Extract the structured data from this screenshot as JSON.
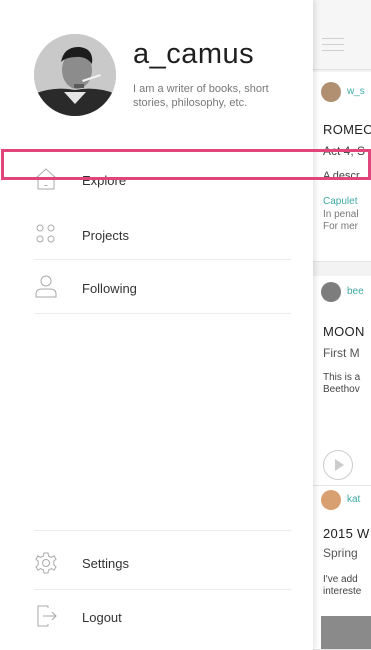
{
  "profile": {
    "username": "a_camus",
    "bio": "I am a writer of books, short stories, philosophy, etc."
  },
  "menu": {
    "explore": "Explore",
    "projects": "Projects",
    "following": "Following",
    "settings": "Settings",
    "logout": "Logout"
  },
  "feed": {
    "card1": {
      "user": "w_s",
      "title": "ROMEO",
      "subtitle": "Act 4, S",
      "desc": "A descr",
      "quote_1": "Capulet",
      "quote_2": "In penal",
      "quote_3": "For mer"
    },
    "card2": {
      "user": "bee",
      "title": "MOON",
      "subtitle": "First M",
      "desc_1": "This is a",
      "desc_2": "Beethov"
    },
    "card3": {
      "user": "kat",
      "title": "2015 W",
      "subtitle": "Spring",
      "desc_1": "I've add",
      "desc_2": "intereste"
    }
  },
  "colors": {
    "highlight": "#e0457b",
    "accent_teal": "#3ea9a3"
  }
}
